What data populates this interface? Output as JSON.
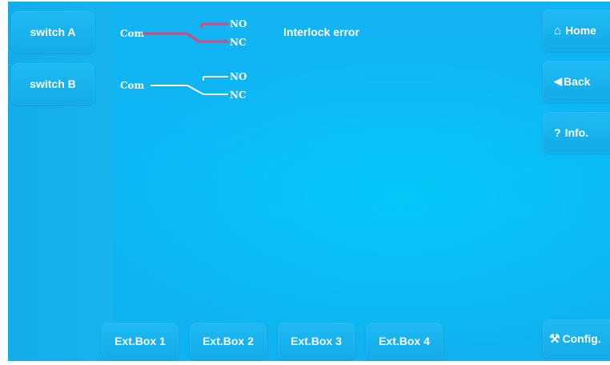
{
  "left_buttons": {
    "switch_a": "switch A",
    "switch_b": "switch B"
  },
  "right_buttons": {
    "home": "Home",
    "back": "Back",
    "info": "Info.",
    "config": "Config."
  },
  "icons": {
    "home": "⌂",
    "back": "◀",
    "info": "?",
    "config": "⚒"
  },
  "bottom_tabs": [
    "Ext.Box 1",
    "Ext.Box 2",
    "Ext.Box 3",
    "Ext.Box 4"
  ],
  "status_message": "Interlock error",
  "switch_a_diagram": {
    "com": "Com",
    "no": "NO",
    "nc": "NC",
    "wire_color": "#d9497e"
  },
  "switch_b_diagram": {
    "com": "Com",
    "no": "NO",
    "nc": "NC",
    "wire_color": "#ffffff"
  }
}
